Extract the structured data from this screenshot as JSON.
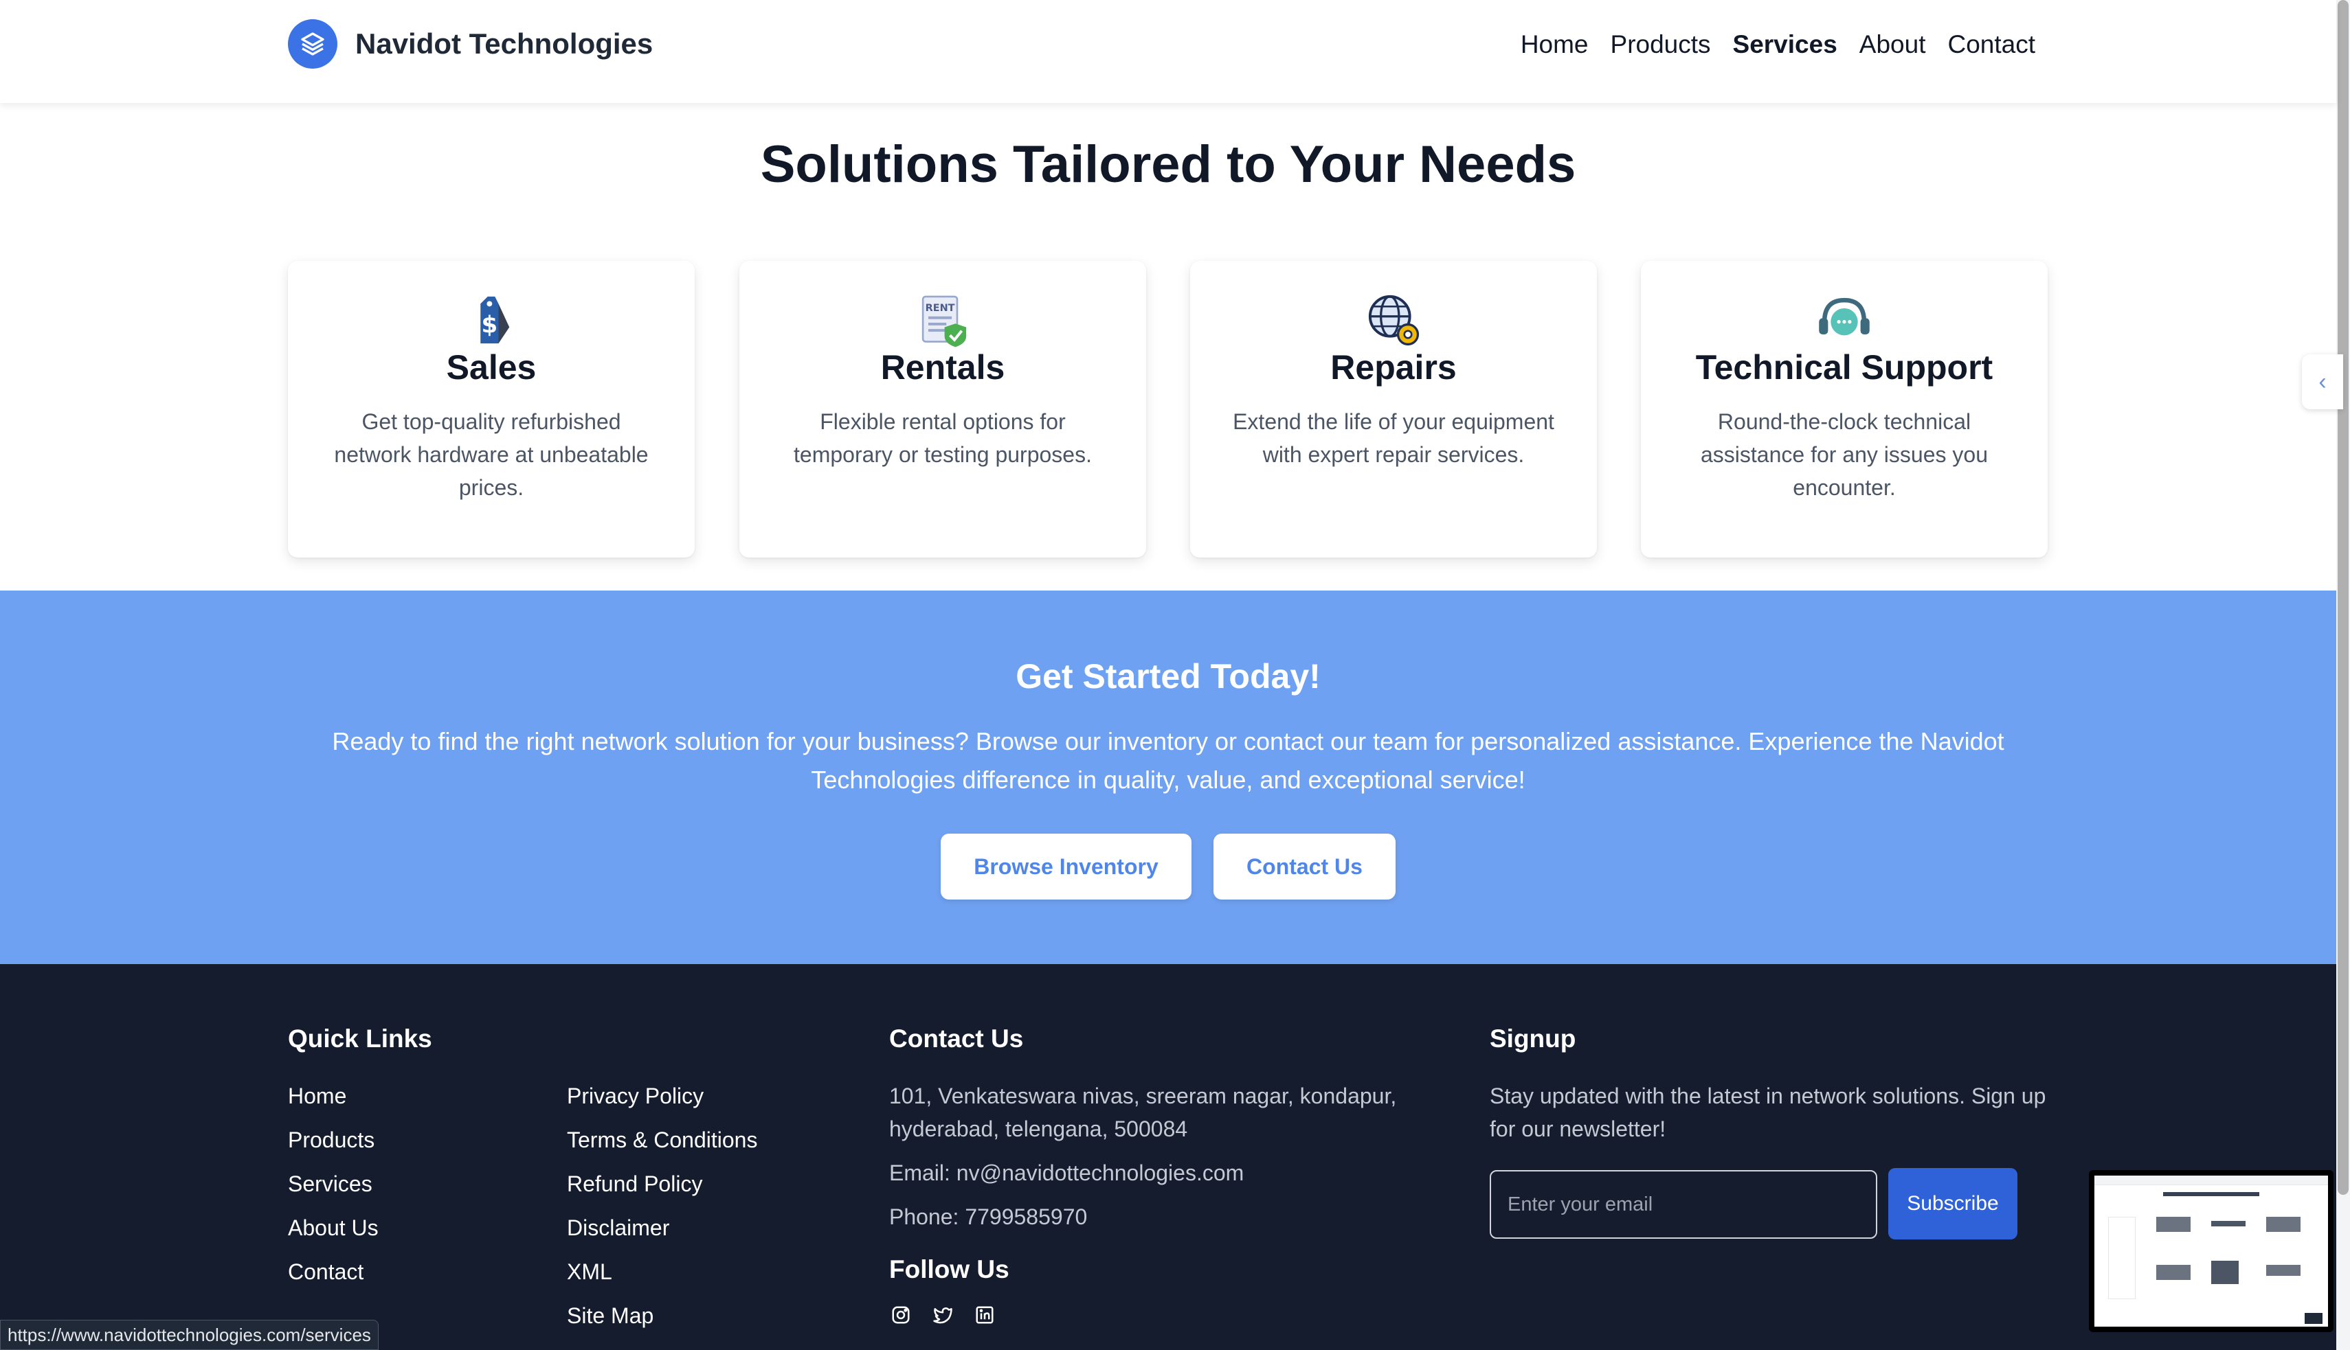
{
  "header": {
    "brand_name": "Navidot Technologies",
    "brand_icon": "layers-icon",
    "nav": [
      {
        "label": "Home",
        "active": false
      },
      {
        "label": "Products",
        "active": false
      },
      {
        "label": "Services",
        "active": true
      },
      {
        "label": "About",
        "active": false
      },
      {
        "label": "Contact",
        "active": false
      }
    ]
  },
  "services": {
    "title": "Solutions Tailored to Your Needs",
    "cards": [
      {
        "icon": "price-tag-icon",
        "title": "Sales",
        "description": "Get top-quality refurbished network hardware at unbeatable prices."
      },
      {
        "icon": "rent-document-icon",
        "title": "Rentals",
        "description": "Flexible rental options for temporary or testing purposes."
      },
      {
        "icon": "globe-gear-icon",
        "title": "Repairs",
        "description": "Extend the life of your equipment with expert repair services."
      },
      {
        "icon": "headset-chat-icon",
        "title": "Technical Support",
        "description": "Round-the-clock technical assistance for any issues you encounter."
      }
    ]
  },
  "cta": {
    "title": "Get Started Today!",
    "text": "Ready to find the right network solution for your business? Browse our inventory or contact our team for personalized assistance. Experience the Navidot Technologies difference in quality, value, and exceptional service!",
    "browse_label": "Browse Inventory",
    "contact_label": "Contact Us"
  },
  "footer": {
    "quick_links_title": "Quick Links",
    "links_col1": [
      "Home",
      "Products",
      "Services",
      "About Us",
      "Contact"
    ],
    "links_col2": [
      "Privacy Policy",
      "Terms & Conditions",
      "Refund Policy",
      "Disclaimer",
      "XML",
      "Site Map"
    ],
    "contact_title": "Contact Us",
    "address": "101, Venkateswara nivas, sreeram nagar, kondapur, hyderabad, telengana, 500084",
    "email": "Email: nv@navidottechnologies.com",
    "phone": "Phone: 7799585970",
    "follow_title": "Follow Us",
    "social_icons": [
      "instagram-icon",
      "twitter-icon",
      "linkedin-icon"
    ],
    "signup_title": "Signup",
    "signup_text": "Stay updated with the latest in network solutions. Sign up for our newsletter!",
    "email_placeholder": "Enter your email",
    "subscribe_label": "Subscribe"
  },
  "status_bar": {
    "url": "https://www.navidottechnologies.com/services"
  },
  "colors": {
    "brand_blue": "#3b72e5",
    "cta_background": "#6fa1f2",
    "footer_background": "#141c2e",
    "subscribe_button": "#2f62d9"
  }
}
